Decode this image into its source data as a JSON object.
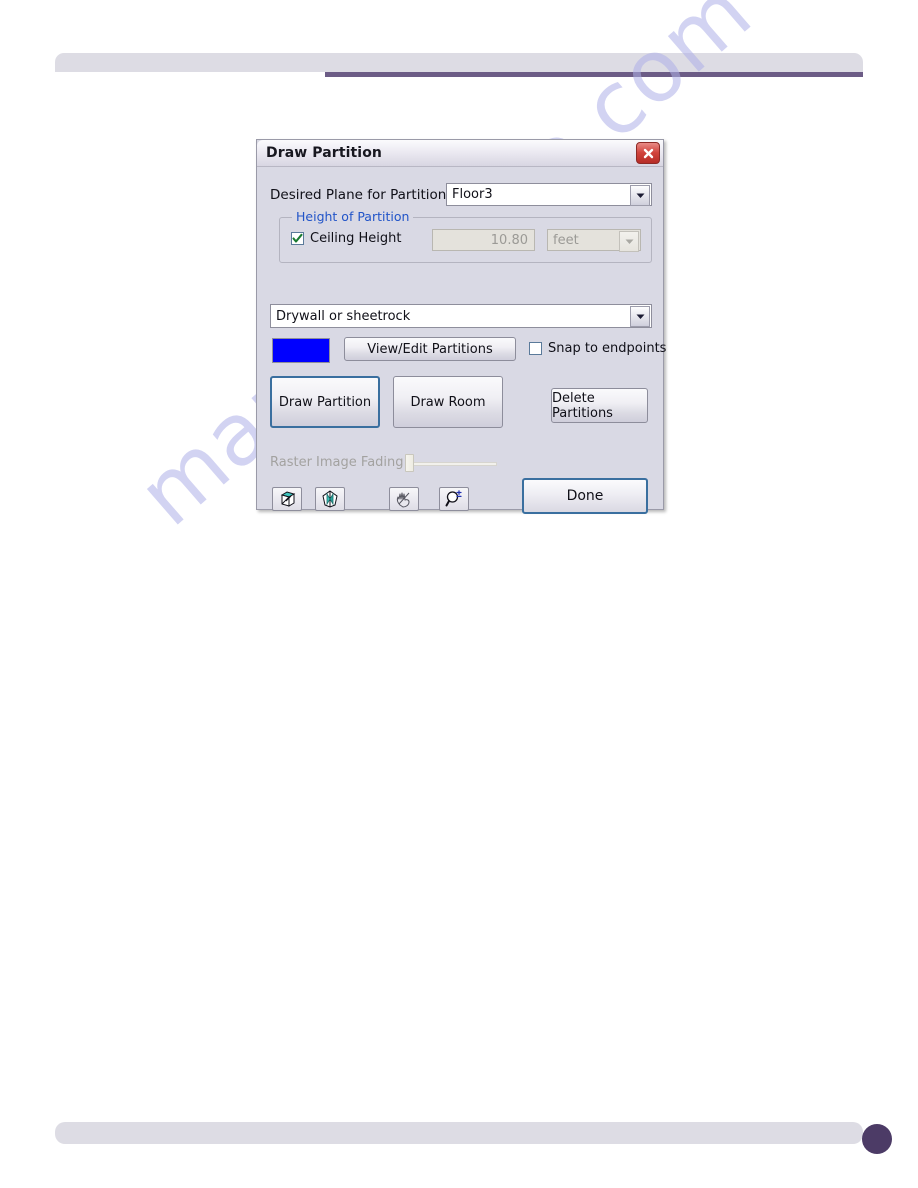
{
  "page": {
    "watermark_text": "manualshive.com",
    "accent_color": "#6c5c86",
    "footer_dot_color": "#4c3b66",
    "header_bar_color": "#dddce4"
  },
  "dialog": {
    "title": "Draw Partition",
    "close_icon": "close-x-icon",
    "plane": {
      "label": "Desired Plane for Partitions:",
      "value": "Floor3",
      "dropdown_icon": "chevron-down-icon"
    },
    "height_group": {
      "title": "Height of Partition",
      "checkbox": {
        "label": "Ceiling Height",
        "checked": true,
        "check_icon": "check-mark-icon"
      },
      "value": "10.80",
      "unit": "feet",
      "unit_dropdown_icon": "chevron-down-icon",
      "disabled": true
    },
    "material": {
      "value": "Drywall or sheetrock",
      "dropdown_icon": "chevron-down-icon"
    },
    "color_swatch": {
      "name": "partition-color-swatch",
      "color": "#0000ff"
    },
    "view_edit_label": "View/Edit Partitions",
    "snap": {
      "label": "Snap to endpoints",
      "checked": false
    },
    "draw_partition_label": "Draw Partition",
    "draw_room_label": "Draw Room",
    "delete_partitions_label": "Delete Partitions",
    "raster": {
      "label": "Raster Image Fading:",
      "value": 0,
      "disabled": true
    },
    "tools": [
      {
        "name": "view-3d-isometric-icon",
        "tooltip": "3D Isometric View"
      },
      {
        "name": "view-3d-wireframe-icon",
        "tooltip": "3D Wireframe View"
      },
      {
        "name": "pan-hand-icon",
        "tooltip": "Pan"
      },
      {
        "name": "zoom-magnifier-icon",
        "tooltip": "Zoom In/Out"
      }
    ],
    "done_label": "Done"
  }
}
